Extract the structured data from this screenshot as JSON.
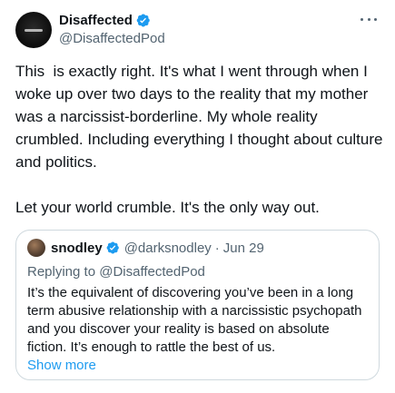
{
  "author": {
    "display_name": "Disaffected",
    "handle": "@DisaffectedPod",
    "verified": true,
    "avatar_icon": "logo-avatar"
  },
  "tweet": {
    "text": "This  is exactly right. It's what I went through when I woke up over two days to the reality that my mother was a narcissist-borderline. My whole reality crumbled. Including everything I thought about culture and politics.\n\nLet your world crumble. It's the only way out."
  },
  "quoted": {
    "display_name": "snodley",
    "handle": "@darksnodley",
    "separator": "·",
    "date": "Jun 29",
    "replying_to": "Replying to @DisaffectedPod",
    "text": "It’s the equivalent of discovering you’ve been in a long term abusive relationship with a narcissistic psychopath and you discover your reality is based on absolute fiction. It’s enough to rattle the best of us.",
    "show_more": "Show more"
  },
  "colors": {
    "text": "#0f1419",
    "secondary": "#536471",
    "accent": "#1d9bf0",
    "border": "#cfd9de"
  }
}
